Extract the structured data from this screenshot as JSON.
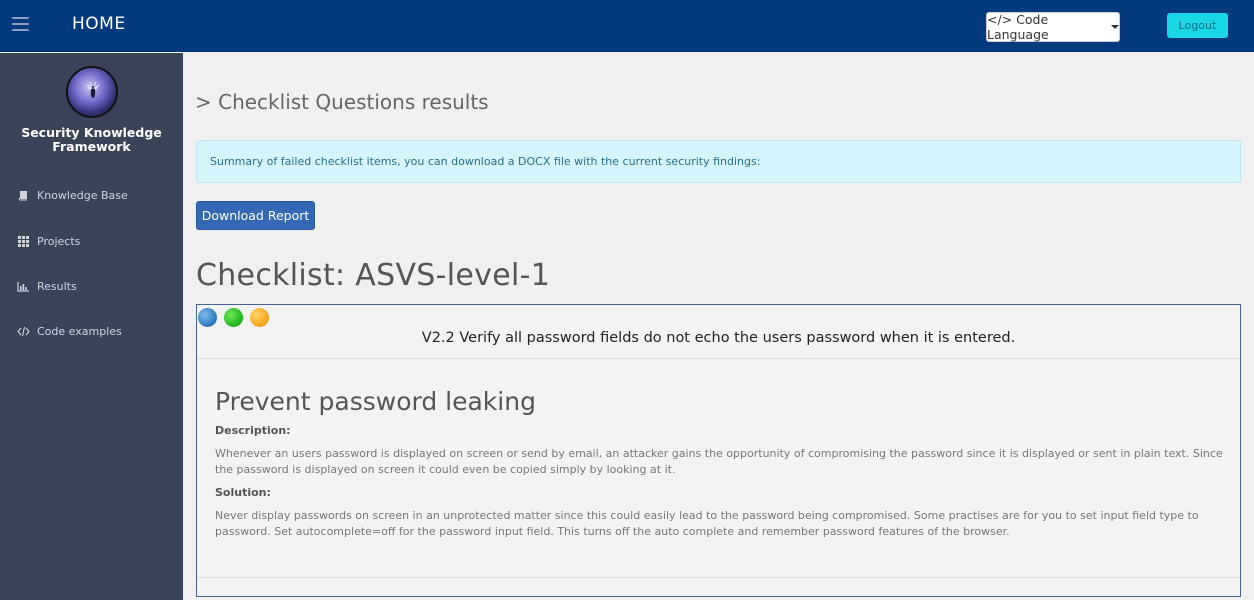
{
  "header": {
    "title": "HOME",
    "code_language_label": "</> Code Language",
    "logout_label": "Logout"
  },
  "sidebar": {
    "brand_line1": "Security Knowledge",
    "brand_line2": "Framework",
    "items": [
      {
        "label": "Knowledge Base",
        "icon": "book-icon"
      },
      {
        "label": "Projects",
        "icon": "grid-icon"
      },
      {
        "label": "Results",
        "icon": "bar-chart-icon"
      },
      {
        "label": "Code examples",
        "icon": "code-icon"
      }
    ]
  },
  "main": {
    "page_title": "> Checklist Questions results",
    "alert_text": "Summary of failed checklist items, you can download a DOCX file with the current security findings:",
    "download_label": "Download Report",
    "checklist_title": "Checklist: ASVS-level-1",
    "question": "V2.2 Verify all password fields do not echo the users password when it is entered.",
    "kb_title": "Prevent password leaking",
    "description_label": "Description:",
    "description_text": "Whenever an users password is displayed on screen or send by email, an attacker gains the opportunity of compromising the password since it is displayed or sent in plain text. Since the password is displayed on screen it could even be copied simply by looking at it.",
    "solution_label": "Solution:",
    "solution_text": "Never display passwords on screen in an unprotected matter since this could easily lead to the password being compromised. Some practises are for you to set input field type to password. Set autocomplete=off for the password input field. This turns off the auto complete and remember password features of the browser."
  },
  "colors": {
    "navbar": "#053a7e",
    "sidebar": "#3a4458",
    "logout": "#1ad7e6",
    "primary_button": "#3369b4",
    "alert_bg": "#d6f4fb",
    "dot_blue": "#2a78c2",
    "dot_green": "#16b815",
    "dot_orange": "#f5a216"
  }
}
